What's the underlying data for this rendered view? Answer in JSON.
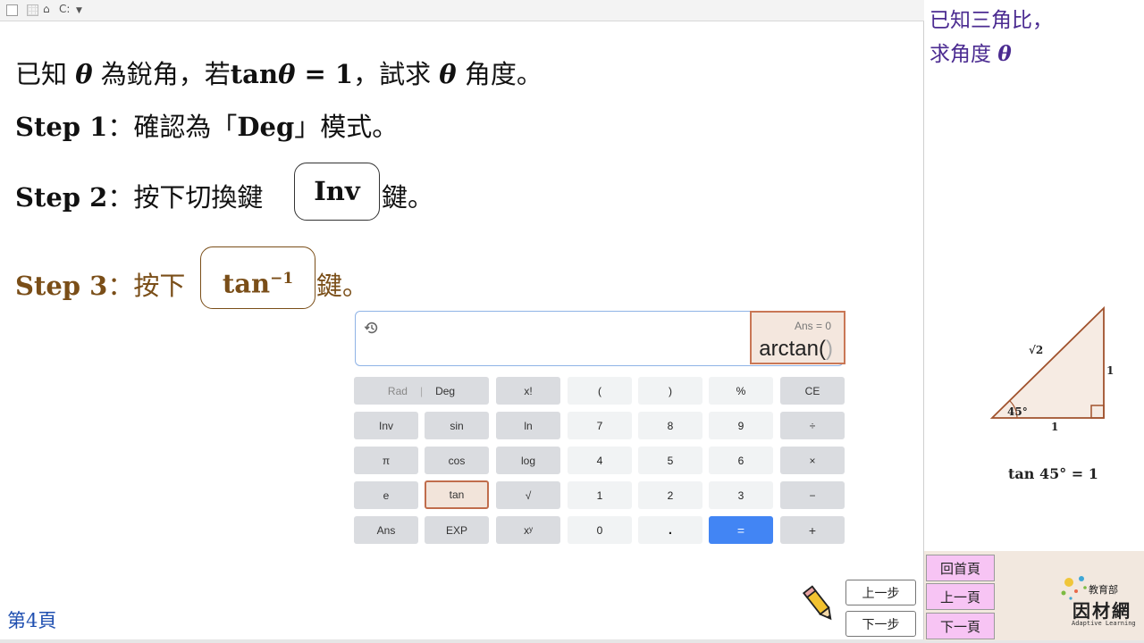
{
  "toolbar": {
    "home_icon": "home-icon",
    "label": "C:",
    "dropdown_icon": "chevron-down-icon"
  },
  "problem": {
    "part1": "已知 ",
    "theta": "θ",
    "part2": " 為銳角，若",
    "tan": "tan",
    "eq": " = 1",
    "part3": "，試求 ",
    "part4": " 角度。"
  },
  "step1": {
    "label": "Step 1",
    "text1": "：確認為「",
    "mode": "Deg",
    "text2": "」模式。"
  },
  "step2": {
    "label": "Step 2",
    "text1": "：按下切換鍵",
    "key": "Inv",
    "text2": "鍵。"
  },
  "step3": {
    "label": "Step 3",
    "text1": "：按下",
    "key": "tan",
    "key_sup": "−1",
    "text2": "鍵。",
    "color": "#7a4e18"
  },
  "calculator": {
    "ans": "Ans = 0",
    "expr": "arctan(",
    "expr_close": ")",
    "rows": [
      [
        {
          "label": "Rad"
        },
        {
          "label": "Deg"
        },
        {
          "label": "x!"
        },
        {
          "label": "("
        },
        {
          "label": ")"
        },
        {
          "label": "%"
        },
        {
          "label": "CE"
        }
      ],
      [
        {
          "label": "Inv"
        },
        {
          "label": "sin"
        },
        {
          "label": "ln"
        },
        {
          "label": "7"
        },
        {
          "label": "8"
        },
        {
          "label": "9"
        },
        {
          "label": "÷"
        }
      ],
      [
        {
          "label": "π"
        },
        {
          "label": "cos"
        },
        {
          "label": "log"
        },
        {
          "label": "4"
        },
        {
          "label": "5"
        },
        {
          "label": "6"
        },
        {
          "label": "×"
        }
      ],
      [
        {
          "label": "e"
        },
        {
          "label": "tan"
        },
        {
          "label": "√"
        },
        {
          "label": "1"
        },
        {
          "label": "2"
        },
        {
          "label": "3"
        },
        {
          "label": "−"
        }
      ],
      [
        {
          "label": "Ans"
        },
        {
          "label": "EXP"
        },
        {
          "label": "xʸ"
        },
        {
          "label": "0"
        },
        {
          "label": "."
        },
        {
          "label": "="
        },
        {
          "label": "+"
        }
      ]
    ]
  },
  "right_panel": {
    "line1": "已知三角比，",
    "line2": "求角度 ",
    "theta": "θ",
    "hyp": "√2",
    "opp": "1",
    "adj": "1",
    "angle": "45°",
    "tan_eq": "tan 45° = 1"
  },
  "nav": {
    "home": "回首頁",
    "prev_page": "上一頁",
    "next_page": "下一頁"
  },
  "steps_nav": {
    "prev": "上一步",
    "next": "下一步"
  },
  "logo": {
    "small": "教育部",
    "name": "因材網",
    "en": "Adaptive Learning"
  },
  "page": "第4頁",
  "colors": {
    "accent_purple": "#4b2b91",
    "step3_brown": "#7a4e18",
    "nav_pink": "#f7c4f4",
    "calc_blue": "#4285f4"
  }
}
